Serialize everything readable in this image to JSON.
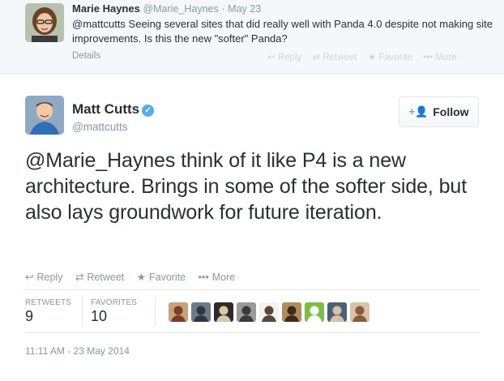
{
  "parent_tweet": {
    "fullname": "Marie Haynes",
    "username": "@Marie_Haynes",
    "separator": "·",
    "date": "May 23",
    "text": "@mattcutts Seeing several sites that did really well with Panda 4.0 despite not making site improvements. Is this the new \"softer\" Panda?",
    "details_label": "Details",
    "actions": [
      {
        "icon": "reply-icon",
        "glyph": "↩",
        "label": "Reply"
      },
      {
        "icon": "retweet-icon",
        "glyph": "⇄",
        "label": "Retweet"
      },
      {
        "icon": "star-icon",
        "glyph": "★",
        "label": "Favorite"
      },
      {
        "icon": "more-icon",
        "glyph": "•••",
        "label": "More"
      }
    ]
  },
  "main_tweet": {
    "fullname": "Matt Cutts",
    "verified_glyph": "✓",
    "username": "@mattcutts",
    "follow_label": "Follow",
    "follow_glyph": "+👤",
    "text": "@Marie_Haynes think of it like P4 is a new architecture. Brings in some of the softer side, but also lays groundwork for future iteration.",
    "actions": [
      {
        "icon": "reply-icon",
        "glyph": "↩",
        "label": "Reply"
      },
      {
        "icon": "retweet-icon",
        "glyph": "⇄",
        "label": "Retweet"
      },
      {
        "icon": "star-icon",
        "glyph": "★",
        "label": "Favorite"
      },
      {
        "icon": "more-icon",
        "glyph": "•••",
        "label": "More"
      }
    ],
    "stats": {
      "retweets_label": "RETWEETS",
      "retweets": "9",
      "favorites_label": "FAVORITES",
      "favorites": "10"
    },
    "timestamp": "11:11 AM - 23 May 2014"
  },
  "colors": {
    "accent": "#55acee",
    "muted": "#8899a6",
    "text": "#292f33",
    "border": "#e1e8ed"
  },
  "favoriter_avatars": [
    {
      "name": "favoriter-avatar",
      "bg": "#c8a07a",
      "fg": "#7a3e28"
    },
    {
      "name": "favoriter-avatar",
      "bg": "#6b7b8c",
      "fg": "#2d3842"
    },
    {
      "name": "favoriter-avatar",
      "bg": "#2b2b2b",
      "fg": "#d9c6a5"
    },
    {
      "name": "favoriter-avatar",
      "bg": "#9a9a9a",
      "fg": "#3b3b3b"
    },
    {
      "name": "favoriter-avatar",
      "bg": "#f2f2f2",
      "fg": "#5a4634"
    },
    {
      "name": "favoriter-avatar",
      "bg": "#b38b5d",
      "fg": "#3d2b1c"
    },
    {
      "name": "favoriter-avatar",
      "bg": "#7bc043",
      "fg": "#ffffff"
    },
    {
      "name": "favoriter-avatar",
      "bg": "#4a6277",
      "fg": "#d8c0a0"
    },
    {
      "name": "favoriter-avatar",
      "bg": "#d7c3a8",
      "fg": "#8a5a3c"
    }
  ]
}
